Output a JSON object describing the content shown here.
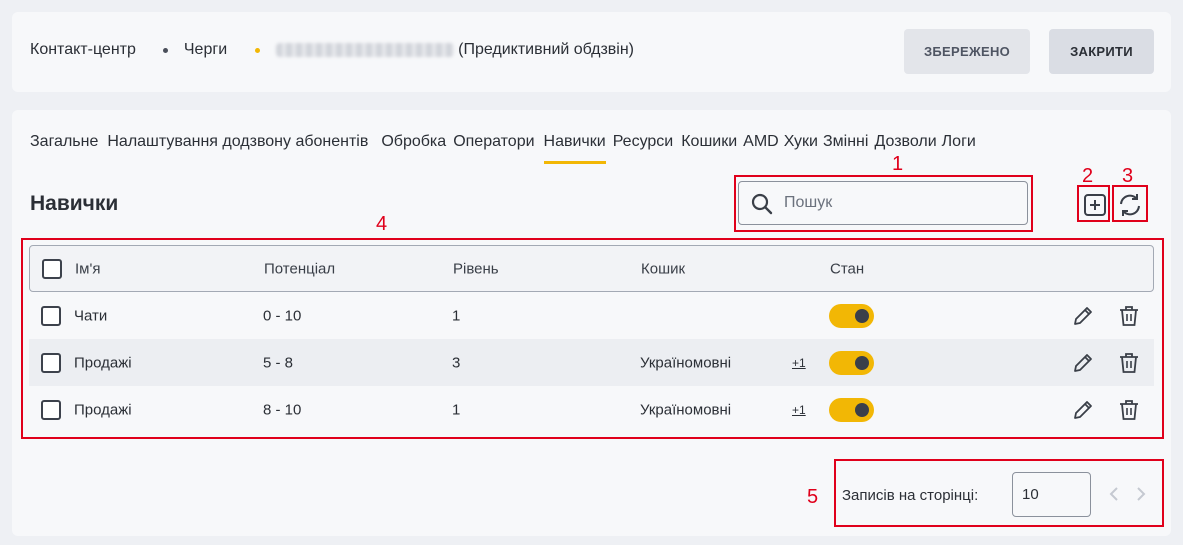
{
  "header": {
    "breadcrumbs": [
      "Контакт-центр",
      "Черги"
    ],
    "queue_suffix": "(Предиктивний обдзвін)",
    "saved_button": "ЗБЕРЕЖЕНО",
    "close_button": "ЗАКРИТИ"
  },
  "tabs": [
    "Загальне",
    "Налаштування додзвону абонентів",
    "Обробка",
    "Оператори",
    "Навички",
    "Ресурси",
    "Кошики",
    "AMD",
    "Хуки",
    "Змінні",
    "Дозволи",
    "Логи"
  ],
  "active_tab": "Навички",
  "section": {
    "title": "Навички"
  },
  "search": {
    "placeholder": "Пошук"
  },
  "table": {
    "columns": [
      "Ім'я",
      "Потенціал",
      "Рівень",
      "Кошик",
      "Стан"
    ],
    "rows": [
      {
        "name": "Чати",
        "potential": "0 - 10",
        "level": "1",
        "basket": "",
        "extra": "",
        "enabled": true
      },
      {
        "name": "Продажі",
        "potential": "5 - 8",
        "level": "3",
        "basket": "Україномовні",
        "extra": "+1",
        "enabled": true
      },
      {
        "name": "Продажі",
        "potential": "8 - 10",
        "level": "1",
        "basket": "Україномовні",
        "extra": "+1",
        "enabled": true
      }
    ]
  },
  "pagination": {
    "label": "Записів на сторінці:",
    "page_size": "10"
  },
  "annotations": [
    "1",
    "2",
    "3",
    "4",
    "5"
  ],
  "colors": {
    "accent": "#f2b705",
    "annotation": "#e0001b"
  },
  "icons": [
    "search-icon",
    "add-icon",
    "refresh-icon",
    "edit-icon",
    "trash-icon",
    "chevron-left-icon",
    "chevron-right-icon"
  ]
}
